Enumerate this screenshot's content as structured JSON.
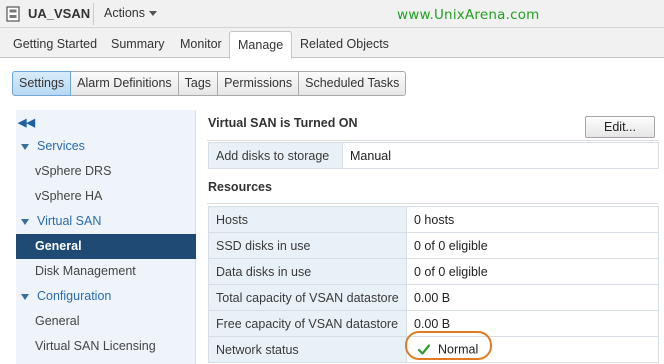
{
  "header": {
    "object_name": "UA_VSAN",
    "actions_label": "Actions",
    "watermark": "www.UnixArena.com",
    "watermark_color": "#22a022"
  },
  "primary_tabs": [
    {
      "label": "Getting Started",
      "active": false
    },
    {
      "label": "Summary",
      "active": false
    },
    {
      "label": "Monitor",
      "active": false
    },
    {
      "label": "Manage",
      "active": true
    },
    {
      "label": "Related Objects",
      "active": false
    }
  ],
  "sub_tabs": [
    {
      "label": "Settings",
      "active": true
    },
    {
      "label": "Alarm Definitions",
      "active": false
    },
    {
      "label": "Tags",
      "active": false
    },
    {
      "label": "Permissions",
      "active": false
    },
    {
      "label": "Scheduled Tasks",
      "active": false
    }
  ],
  "sidebar": {
    "collapse_icon": "double-chevron-left-icon",
    "items": [
      {
        "label": "Services",
        "type": "group"
      },
      {
        "label": "vSphere DRS",
        "type": "item"
      },
      {
        "label": "vSphere HA",
        "type": "item"
      },
      {
        "label": "Virtual SAN",
        "type": "group"
      },
      {
        "label": "General",
        "type": "item",
        "selected": true
      },
      {
        "label": "Disk Management",
        "type": "item"
      },
      {
        "label": "Configuration",
        "type": "group"
      },
      {
        "label": "General",
        "type": "item"
      },
      {
        "label": "Virtual SAN Licensing",
        "type": "item"
      }
    ]
  },
  "main": {
    "vsan_status_title": "Virtual SAN is Turned ON",
    "edit_label": "Edit...",
    "add_disks": {
      "label": "Add disks to storage",
      "value": "Manual"
    },
    "resources_title": "Resources",
    "resources": [
      {
        "label": "Hosts",
        "value": "0 hosts"
      },
      {
        "label": "SSD disks in use",
        "value": "0 of 0 eligible"
      },
      {
        "label": "Data disks in use",
        "value": "0 of 0 eligible"
      },
      {
        "label": "Total capacity of VSAN datastore",
        "value": "0.00 B"
      },
      {
        "label": "Free capacity of VSAN datastore",
        "value": "0.00 B"
      }
    ],
    "network_status": {
      "label": "Network status",
      "value": "Normal",
      "icon": "green-check-icon"
    },
    "highlight_color": "#e07b23"
  }
}
